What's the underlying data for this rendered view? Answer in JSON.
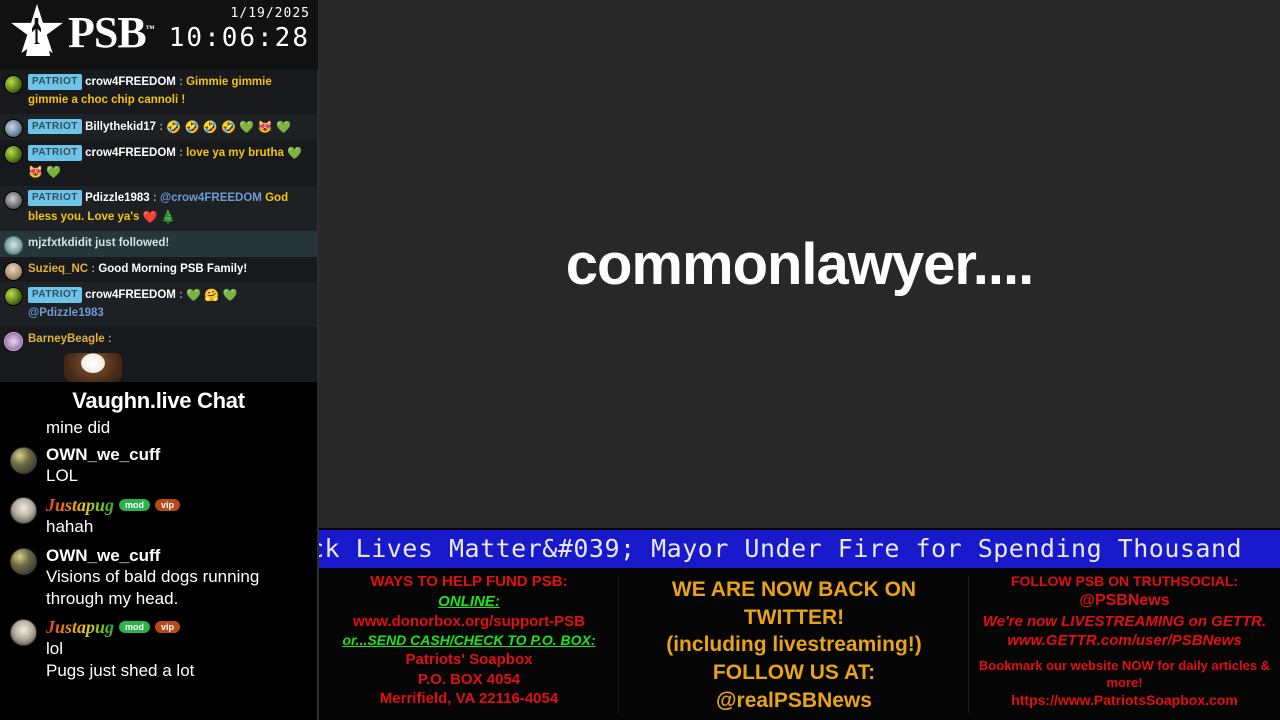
{
  "header": {
    "brand": "PSB",
    "brand_tm": "™",
    "date": "1/19/2025",
    "time": "10:06:28",
    "logo_icon": "psb-star-soapbox-logo"
  },
  "top_chat": {
    "messages": [
      {
        "avatar_icon": "avatar-crow4freedom",
        "badge": "PATRIOT",
        "user": "crow4FREEDOM",
        "colon": ":",
        "text": "Gimmie gimmie gimmie a choc chip cannoli !",
        "type": "message",
        "emotes": ""
      },
      {
        "avatar_icon": "avatar-billythekid17",
        "badge": "PATRIOT",
        "user": "Billythekid17",
        "colon": ":",
        "text": "",
        "type": "message",
        "emotes": "🤣 🤣 🤣 🤣 💚 😻 💚"
      },
      {
        "avatar_icon": "avatar-crow4freedom",
        "badge": "PATRIOT",
        "user": "crow4FREEDOM",
        "colon": ":",
        "text": "love ya my brutha",
        "type": "message",
        "emotes": "💚 😻 💚"
      },
      {
        "avatar_icon": "avatar-pdizzle1983",
        "badge": "PATRIOT",
        "user": "Pdizzle1983",
        "colon": ":",
        "mention": "@crow4FREEDOM",
        "text": "God bless you. Love ya's",
        "type": "message",
        "emotes": "❤️ 🎄"
      },
      {
        "avatar_icon": "avatar-follower",
        "text": "mjzfxtkdidit just followed!",
        "type": "follow"
      },
      {
        "avatar_icon": "avatar-suzieq",
        "user": "Suzieq_NC",
        "colon": ":",
        "text": "Good Morning PSB Family!",
        "type": "message",
        "name_color": "gold"
      },
      {
        "avatar_icon": "avatar-crow4freedom",
        "badge": "PATRIOT",
        "user": "crow4FREEDOM",
        "colon": ":",
        "text": "",
        "type": "message",
        "emotes": "💚 🤗 💚",
        "mention_after": "@Pdizzle1983"
      },
      {
        "avatar_icon": "avatar-barneybeagle",
        "user": "BarneyBeagle",
        "colon": ":",
        "text": "",
        "type": "message",
        "name_color": "gold",
        "image_icon": "coffee-cup-image"
      }
    ]
  },
  "vaughn": {
    "title": "Vaughn.live Chat",
    "continuation": "mine did",
    "messages": [
      {
        "avatar_icon": "avatar-own-we-cuff",
        "user": "OWN_we_cuff",
        "badges": [],
        "text": "LOL"
      },
      {
        "avatar_icon": "avatar-justapug",
        "user": "Justapug",
        "badges": [
          "mod",
          "vip"
        ],
        "text": "hahah"
      },
      {
        "avatar_icon": "avatar-own-we-cuff",
        "user": "OWN_we_cuff",
        "badges": [],
        "text": "Visions of bald dogs running through my head."
      },
      {
        "avatar_icon": "avatar-justapug",
        "user": "Justapug",
        "badges": [
          "mod",
          "vip"
        ],
        "text": "lol\nPugs just shed a lot"
      }
    ]
  },
  "video": {
    "overlay_text": "commonlawyer...."
  },
  "ticker": {
    "text": "ck Lives Matter&#039; Mayor Under Fire for Spending Thousand"
  },
  "banner": {
    "left": {
      "l1": "WAYS TO HELP FUND PSB:",
      "l2": "ONLINE:",
      "l3": "www.donorbox.org/support-PSB",
      "l4": "or...SEND CASH/CHECK TO P.O. BOX:",
      "l5": "Patriots' Soapbox",
      "l6": "P.O. BOX 4054",
      "l7": "Merrifield, VA 22116-4054"
    },
    "center": {
      "l1": "WE ARE NOW BACK ON TWITTER!",
      "l2": "(including livestreaming!)",
      "l3": "FOLLOW US AT:",
      "l4": "@realPSBNews"
    },
    "right": {
      "l1": "FOLLOW PSB ON TRUTHSOCIAL:",
      "l2": "@PSBNews",
      "l3": "We're now LIVESTREAMING on GETTR.",
      "l4": "www.GETTR.com/user/PSBNews",
      "l5": "Bookmark our website NOW for daily articles & more!",
      "l6": "https://www.PatriotsSoapbox.com"
    }
  }
}
